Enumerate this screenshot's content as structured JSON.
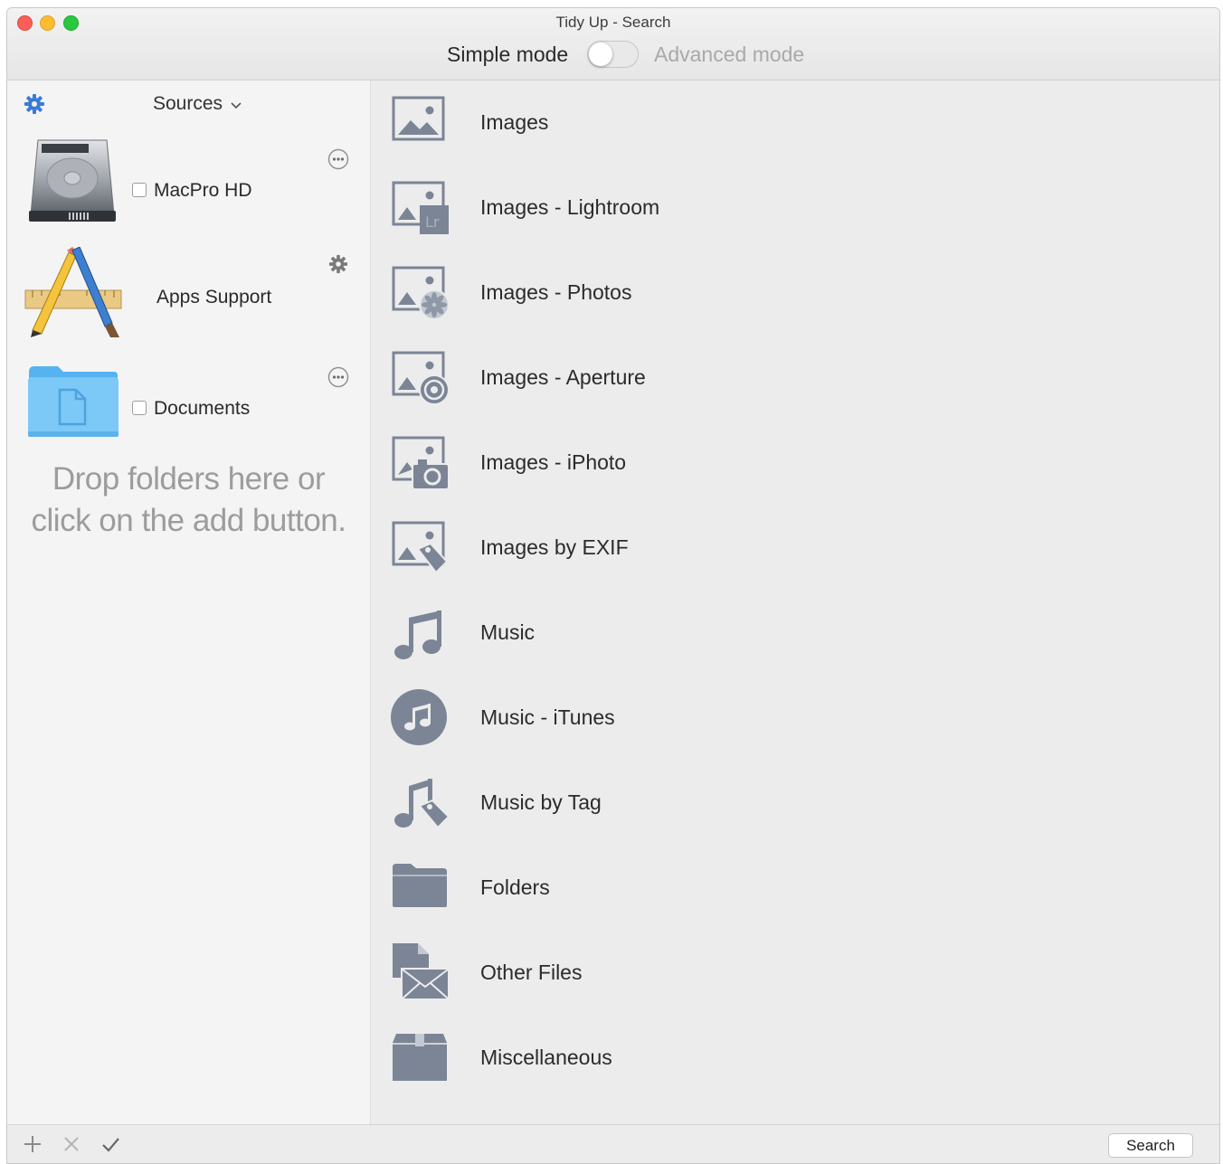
{
  "window": {
    "title": "Tidy Up - Search",
    "mode_simple": "Simple mode",
    "mode_advanced": "Advanced mode",
    "mode_toggle_on": false
  },
  "sidebar": {
    "sources_label": "Sources",
    "items": [
      {
        "label": "MacPro HD",
        "icon": "hard-drive-icon",
        "has_checkbox": true,
        "checked": false,
        "action_icon": "more-icon"
      },
      {
        "label": "Apps Support",
        "icon": "app-store-tools-icon",
        "has_checkbox": false,
        "action_icon": "gear-icon"
      },
      {
        "label": "Documents",
        "icon": "folder-document-icon",
        "has_checkbox": true,
        "checked": false,
        "action_icon": "more-icon"
      }
    ],
    "drop_hint_line1": "Drop folders here or",
    "drop_hint_line2": "click on the add button."
  },
  "categories": [
    {
      "label": "Images",
      "icon": "image-icon"
    },
    {
      "label": "Images - Lightroom",
      "icon": "image-lightroom-icon"
    },
    {
      "label": "Images - Photos",
      "icon": "image-photos-icon"
    },
    {
      "label": "Images - Aperture",
      "icon": "image-aperture-icon"
    },
    {
      "label": "Images - iPhoto",
      "icon": "image-iphoto-icon"
    },
    {
      "label": "Images by EXIF",
      "icon": "image-exif-icon"
    },
    {
      "label": "Music",
      "icon": "music-note-icon"
    },
    {
      "label": "Music - iTunes",
      "icon": "itunes-icon"
    },
    {
      "label": "Music by Tag",
      "icon": "music-tag-icon"
    },
    {
      "label": "Folders",
      "icon": "folder-icon"
    },
    {
      "label": "Other Files",
      "icon": "other-files-icon"
    },
    {
      "label": "Miscellaneous",
      "icon": "box-icon"
    }
  ],
  "bottombar": {
    "search_button": "Search"
  },
  "colors": {
    "icon_gray": "#7b8596",
    "accent_blue": "#3a7bd5",
    "close": "#fc5f57",
    "minimize": "#fdbc2e",
    "maximize": "#28c840"
  }
}
